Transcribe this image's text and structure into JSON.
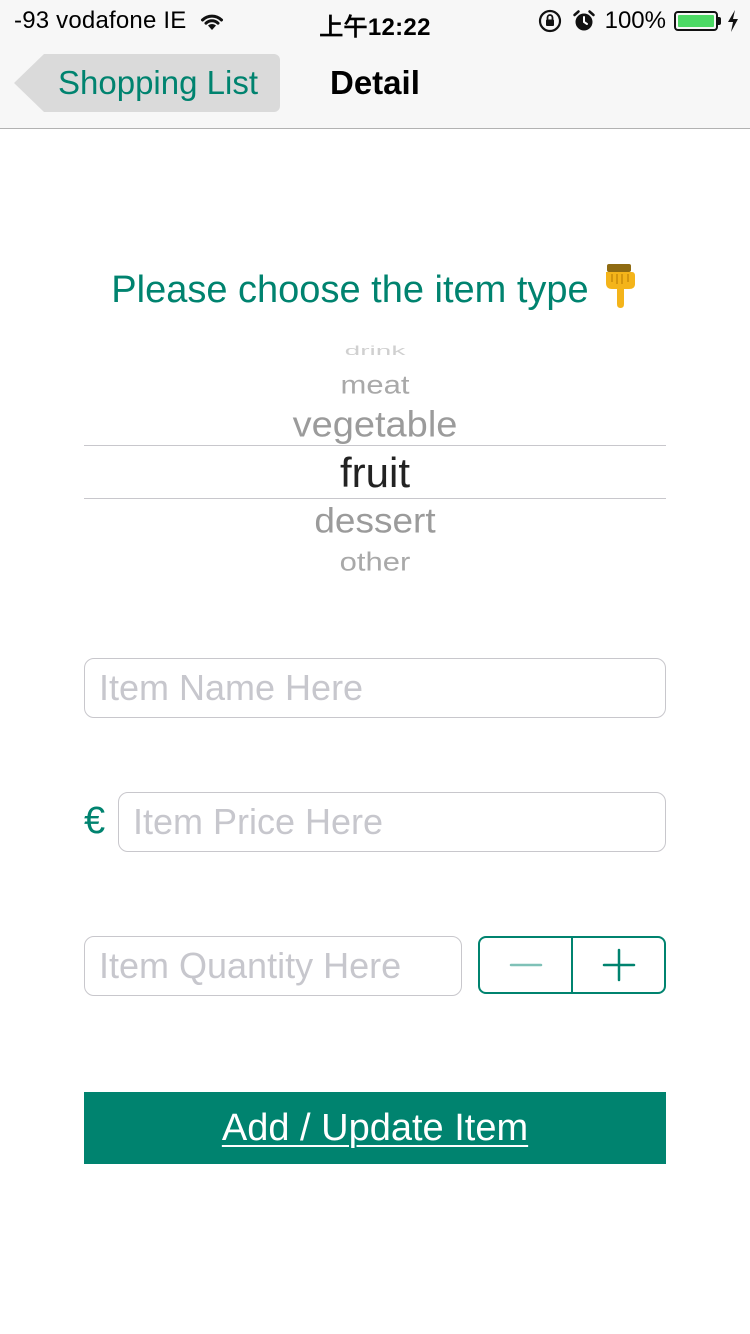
{
  "status_bar": {
    "carrier": "-93 vodafone IE",
    "time": "上午12:22",
    "battery_percent": "100%",
    "battery_level": 1.0
  },
  "nav": {
    "back_label": "Shopping List",
    "title": "Detail"
  },
  "prompt": {
    "text": "Please choose the item type",
    "icon": "pointing-down-hand-icon"
  },
  "picker": {
    "options": [
      "drink",
      "meat",
      "vegetable",
      "fruit",
      "dessert",
      "other"
    ],
    "selected": "fruit"
  },
  "form": {
    "name_placeholder": "Item Name Here",
    "currency_symbol": "€",
    "price_placeholder": "Item Price Here",
    "quantity_placeholder": "Item Quantity Here",
    "stepper_icons": [
      "minus-icon",
      "plus-icon"
    ],
    "submit_label": "Add / Update Item"
  },
  "colors": {
    "accent": "#00836f",
    "placeholder": "#c7c7cd",
    "picker_dim": "#9b9b9b",
    "battery": "#4cd964"
  }
}
